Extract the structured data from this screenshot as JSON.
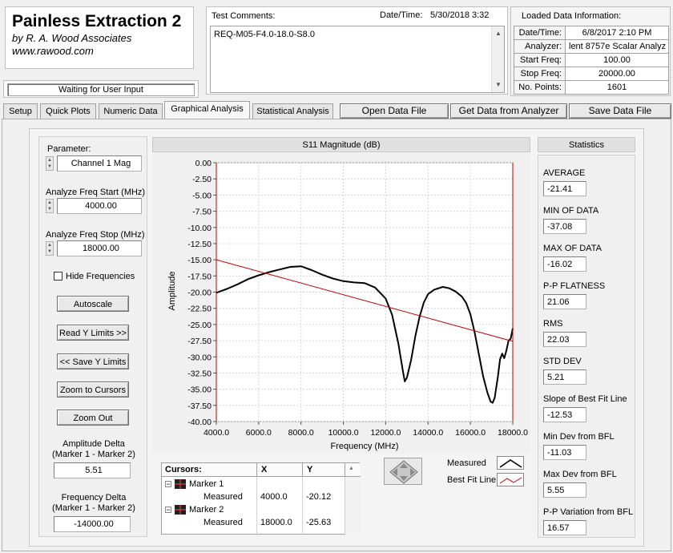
{
  "app": {
    "title": "Painless Extraction 2",
    "company": "by R. A. Wood Associates",
    "website": "www.rawood.com",
    "status": "Waiting for User Input"
  },
  "test": {
    "comments_label": "Test Comments:",
    "comments_value": "REQ-M05-F4.0-18.0-S8.0",
    "datetime_label": "Date/Time:",
    "datetime_value": "5/30/2018  3:32"
  },
  "loaded": {
    "title": "Loaded Data Information:",
    "rows": [
      {
        "label": "Date/Time:",
        "value": "6/8/2017 2:10 PM"
      },
      {
        "label": "Analyzer:",
        "value": "lent 8757e Scalar Analyz"
      },
      {
        "label": "Start Freq:",
        "value": "100.00"
      },
      {
        "label": "Stop Freq:",
        "value": "20000.00"
      },
      {
        "label": "No. Points:",
        "value": "1601"
      }
    ]
  },
  "tabs": [
    "Setup",
    "Quick Plots",
    "Numeric Data",
    "Graphical Analysis",
    "Statistical Analysis"
  ],
  "toolbar": {
    "open": "Open Data File",
    "get": "Get Data from Analyzer",
    "save": "Save Data File"
  },
  "left": {
    "parameter_label": "Parameter:",
    "parameter_value": "Channel 1 Mag",
    "start_label": "Analyze Freq Start (MHz)",
    "start_value": "4000.00",
    "stop_label": "Analyze Freq Stop (MHz)",
    "stop_value": "18000.00",
    "hide_freq": "Hide Frequencies",
    "autoscale": "Autoscale",
    "read_y": "Read Y Limits >>",
    "save_y": "<< Save Y Limits",
    "zoom_cursors": "Zoom to Cursors",
    "zoom_out": "Zoom Out",
    "amp_delta_label1": "Amplitude Delta",
    "amp_delta_label2": "(Marker 1 - Marker 2)",
    "amp_delta_value": "5.51",
    "freq_delta_label1": "Frequency Delta",
    "freq_delta_label2": "(Marker 1 - Marker 2)",
    "freq_delta_value": "-14000.00"
  },
  "cursors": {
    "header": [
      "Cursors:",
      "X",
      "Y"
    ],
    "markers": [
      {
        "name": "Marker 1",
        "sub": "Measured",
        "x": "4000.0",
        "y": "-20.12"
      },
      {
        "name": "Marker 2",
        "sub": "Measured",
        "x": "18000.0",
        "y": "-25.63"
      }
    ]
  },
  "legend": {
    "measured": "Measured",
    "bfl": "Best Fit Line"
  },
  "stats": {
    "title": "Statistics",
    "items": [
      {
        "label": "AVERAGE",
        "value": "-21.41"
      },
      {
        "label": "MIN OF DATA",
        "value": "-37.08"
      },
      {
        "label": "MAX OF DATA",
        "value": "-16.02"
      },
      {
        "label": "P-P FLATNESS",
        "value": "21.06"
      },
      {
        "label": "RMS",
        "value": "22.03"
      },
      {
        "label": "STD DEV",
        "value": "5.21"
      },
      {
        "label": "Slope of Best Fit Line",
        "value": "-12.53"
      },
      {
        "label": "Min Dev from BFL",
        "value": "-11.03"
      },
      {
        "label": "Max Dev from BFL",
        "value": "5.55"
      },
      {
        "label": "P-P Variation from BFL",
        "value": "16.57"
      }
    ]
  },
  "chart_data": {
    "type": "line",
    "title": "S11 Magnitude (dB)",
    "xlabel": "Frequency (MHz)",
    "ylabel": "Amplitude",
    "xlim": [
      4000,
      18000
    ],
    "ylim": [
      -40,
      0
    ],
    "xticks": [
      "4000.0",
      "6000.0",
      "8000.0",
      "10000.0",
      "12000.0",
      "14000.0",
      "16000.0",
      "18000.0"
    ],
    "yticks": [
      "0.00",
      "-2.50",
      "-5.00",
      "-7.50",
      "-10.00",
      "-12.50",
      "-15.00",
      "-17.50",
      "-20.00",
      "-22.50",
      "-25.00",
      "-27.50",
      "-30.00",
      "-32.50",
      "-35.00",
      "-37.50",
      "-40.00"
    ],
    "grid": true,
    "series": [
      {
        "name": "Measured",
        "color": "#000000",
        "x": [
          4000,
          4500,
          5000,
          5500,
          6000,
          6500,
          7000,
          7500,
          8000,
          8500,
          9000,
          9500,
          10000,
          10500,
          11000,
          11500,
          12000,
          12300,
          12600,
          12800,
          12900,
          13000,
          13200,
          13400,
          13600,
          13800,
          14000,
          14300,
          14700,
          15000,
          15300,
          15600,
          15800,
          16000,
          16200,
          16400,
          16600,
          16800,
          16950,
          17050,
          17150,
          17300,
          17400,
          17500,
          17600,
          17700,
          17800,
          17900,
          18000
        ],
        "y": [
          -20.1,
          -19.5,
          -18.8,
          -18.0,
          -17.4,
          -16.9,
          -16.5,
          -16.1,
          -16.0,
          -16.6,
          -17.3,
          -17.9,
          -18.3,
          -18.5,
          -18.6,
          -19.3,
          -21.0,
          -23.5,
          -28.0,
          -32.0,
          -33.8,
          -33.2,
          -30.5,
          -26.8,
          -23.8,
          -21.6,
          -20.3,
          -19.6,
          -19.2,
          -19.4,
          -19.9,
          -20.7,
          -21.7,
          -23.4,
          -26.2,
          -29.6,
          -33.0,
          -35.5,
          -36.9,
          -37.1,
          -36.3,
          -33.0,
          -30.4,
          -29.5,
          -30.2,
          -29.0,
          -27.5,
          -27.2,
          -25.6
        ]
      },
      {
        "name": "Best Fit Line",
        "color": "#cc0000",
        "x": [
          4000,
          18000
        ],
        "y": [
          -15.0,
          -27.6
        ]
      }
    ]
  },
  "colors": {
    "measured": "#000000",
    "bfl": "#cc0000",
    "accent_red": "#c00000"
  }
}
